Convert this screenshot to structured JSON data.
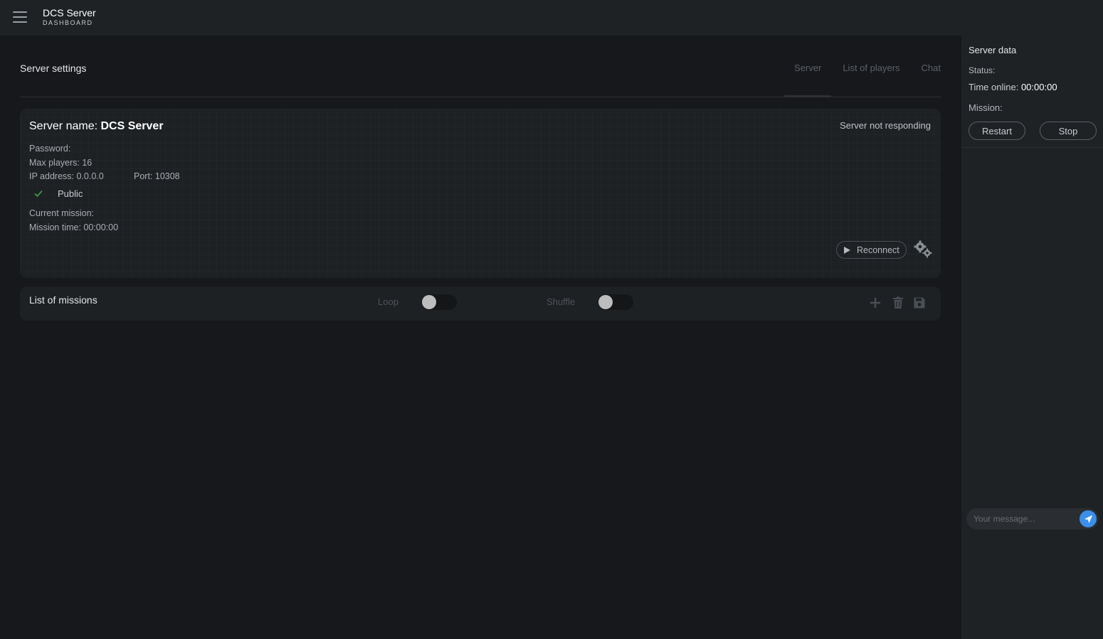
{
  "header": {
    "title": "DCS Server",
    "subtitle": "DASHBOARD"
  },
  "main": {
    "title": "Server settings",
    "tabs": [
      {
        "label": "Server",
        "active": true
      },
      {
        "label": "List of players",
        "active": false
      },
      {
        "label": "Chat",
        "active": false
      }
    ],
    "server_card": {
      "name_label": "Server name:",
      "name_value": "DCS Server",
      "status": "Server not responding",
      "password_label": "Password:",
      "max_players": "Max players: 16",
      "ip_address": "IP address: 0.0.0.0",
      "port": "Port: 10308",
      "public_label": "Public",
      "public_checked": true,
      "current_mission": "Current mission:",
      "mission_time": "Mission time: 00:00:00",
      "reconnect_label": "Reconnect"
    },
    "missions": {
      "title": "List of missions",
      "loop_label": "Loop",
      "loop_on": false,
      "shuffle_label": "Shuffle",
      "shuffle_on": false
    }
  },
  "right_panel": {
    "title": "Server data",
    "status_label": "Status:",
    "time_online_label": "Time online:",
    "time_online_value": "00:00:00",
    "mission_label": "Mission:",
    "restart_label": "Restart",
    "stop_label": "Stop",
    "message_placeholder": "Your message..."
  },
  "colors": {
    "background": "#16181b",
    "panel": "#1f2225",
    "card": "#1e2124",
    "accent": "#3b8fe8",
    "check": "#3da64a"
  }
}
